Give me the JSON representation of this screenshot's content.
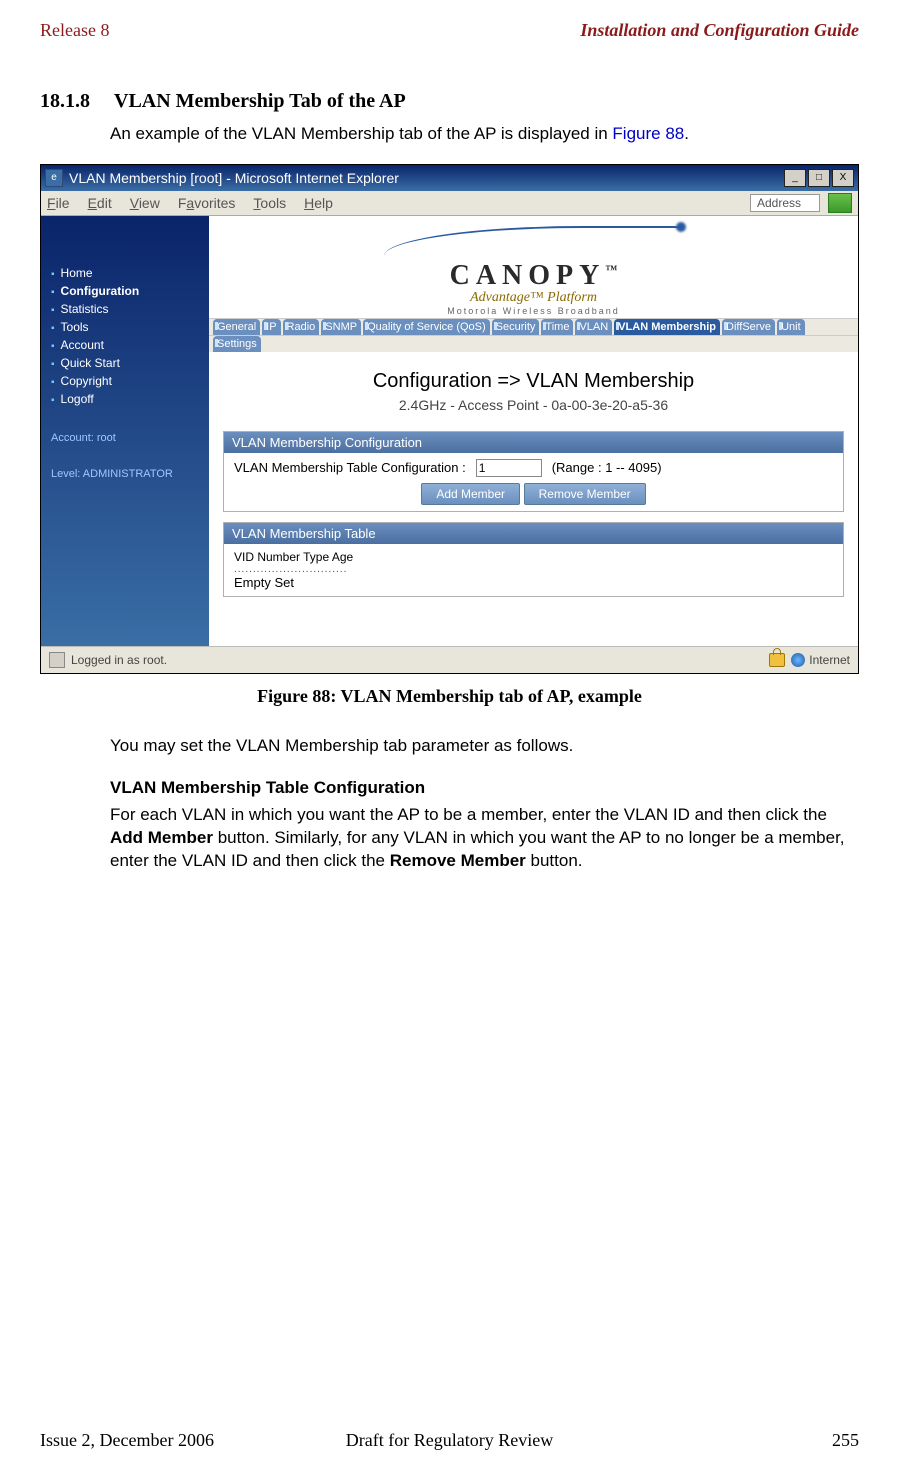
{
  "header": {
    "left": "Release 8",
    "right": "Installation and Configuration Guide"
  },
  "section": {
    "number": "18.1.8",
    "title": "VLAN Membership Tab of the AP"
  },
  "intro": {
    "text_a": "An example of the VLAN Membership tab of the AP is displayed in ",
    "link": "Figure 88",
    "text_b": "."
  },
  "ie": {
    "title": "VLAN Membership [root] - Microsoft Internet Explorer",
    "menu": {
      "file": "File",
      "edit": "Edit",
      "view": "View",
      "fav": "Favorites",
      "tools": "Tools",
      "help": "Help",
      "address_label": "Address"
    },
    "winbuttons": {
      "min": "_",
      "max": "□",
      "close": "X"
    }
  },
  "sidebar": {
    "items": [
      "Home",
      "Configuration",
      "Statistics",
      "Tools",
      "Account",
      "Quick Start",
      "Copyright",
      "Logoff"
    ],
    "acct1": "Account: root",
    "acct2": "Level: ADMINISTRATOR"
  },
  "brand": {
    "name": "CANOPY",
    "tm": "™",
    "sub": "Advantage™ Platform",
    "small": "Motorola Wireless Broadband"
  },
  "tabs": {
    "row1": [
      "General",
      "IP",
      "Radio",
      "SNMP",
      "Quality of Service (QoS)",
      "Security",
      "Time",
      "VLAN",
      "VLAN Membership",
      "DiffServe",
      "Unit"
    ],
    "row2": [
      "Settings"
    ],
    "active_index": 8
  },
  "cfg": {
    "title": "Configuration => VLAN Membership",
    "sub": "2.4GHz - Access Point - 0a-00-3e-20-a5-36",
    "panel1_hd": "VLAN Membership Configuration",
    "panel1_label": "VLAN Membership Table Configuration :",
    "panel1_value": "1",
    "panel1_range": "(Range : 1 -- 4095)",
    "btn_add": "Add Member",
    "btn_remove": "Remove Member",
    "panel2_hd": "VLAN Membership Table",
    "panel2_cols": "VID Number   Type   Age",
    "panel2_empty": "Empty Set"
  },
  "status": {
    "left": "Logged in as root.",
    "right": "Internet"
  },
  "caption": "Figure 88: VLAN Membership tab of AP, example",
  "para1": "You may set the VLAN Membership tab parameter as follows.",
  "subhead": "VLAN Membership Table Configuration",
  "para2_a": "For each VLAN in which you want the AP to be a member, enter the VLAN ID and then click the ",
  "para2_b": "Add Member",
  "para2_c": " button. Similarly, for any VLAN in which you want the AP to no longer be a member, enter the VLAN ID and then click the ",
  "para2_d": "Remove Member",
  "para2_e": " button.",
  "footer": {
    "left": "Issue 2, December 2006",
    "center": "Draft for Regulatory Review",
    "right": "255"
  }
}
